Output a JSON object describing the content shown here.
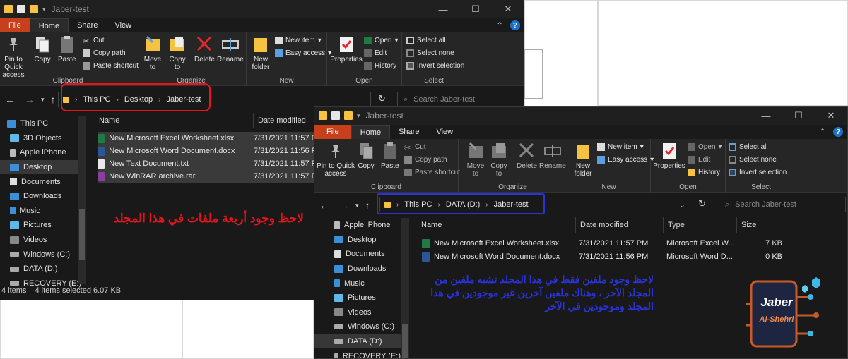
{
  "window1": {
    "title": "Jaber-test",
    "tabs": [
      "File",
      "Home",
      "Share",
      "View"
    ],
    "ribbon": {
      "clipboard": {
        "pin": "Pin to Quick access",
        "copy": "Copy",
        "paste": "Paste",
        "cut": "Cut",
        "copy_path": "Copy path",
        "paste_shortcut": "Paste shortcut",
        "label": "Clipboard"
      },
      "organize": {
        "move_to": "Move to",
        "copy_to": "Copy to",
        "delete": "Delete",
        "rename": "Rename",
        "label": "Organize"
      },
      "new": {
        "new_folder": "New folder",
        "new_item": "New item",
        "easy_access": "Easy access",
        "label": "New"
      },
      "open": {
        "properties": "Properties",
        "open": "Open",
        "edit": "Edit",
        "history": "History",
        "label": "Open"
      },
      "select": {
        "select_all": "Select all",
        "select_none": "Select none",
        "invert": "Invert selection",
        "label": "Select"
      }
    },
    "breadcrumb": [
      "This PC",
      "Desktop",
      "Jaber-test"
    ],
    "search_placeholder": "Search Jaber-test",
    "nav": [
      "This PC",
      "3D Objects",
      "Apple iPhone",
      "Desktop",
      "Documents",
      "Downloads",
      "Music",
      "Pictures",
      "Videos",
      "Windows (C:)",
      "DATA (D:)",
      "RECOVERY (E:)"
    ],
    "columns": [
      "Name",
      "Date modified"
    ],
    "files": [
      {
        "name": "New Microsoft Excel Worksheet.xlsx",
        "date": "7/31/2021 11:57 P"
      },
      {
        "name": "New Microsoft Word Document.docx",
        "date": "7/31/2021 11:56 P"
      },
      {
        "name": "New Text Document.txt",
        "date": "7/31/2021 11:57 P"
      },
      {
        "name": "New WinRAR archive.rar",
        "date": "7/31/2021 11:57 P"
      }
    ],
    "status": {
      "count": "4 items",
      "selected": "4 items selected  6.07 KB"
    },
    "note": "لاحظ وجود أربعة ملفات في هذا المجلد"
  },
  "window2": {
    "title": "Jaber-test",
    "tabs": [
      "File",
      "Home",
      "Share",
      "View"
    ],
    "ribbon": {
      "clipboard": {
        "pin": "Pin to Quick access",
        "copy": "Copy",
        "paste": "Paste",
        "cut": "Cut",
        "copy_path": "Copy path",
        "paste_shortcut": "Paste shortcut",
        "label": "Clipboard"
      },
      "organize": {
        "move_to": "Move to",
        "copy_to": "Copy to",
        "delete": "Delete",
        "rename": "Rename",
        "label": "Organize"
      },
      "new": {
        "new_folder": "New folder",
        "new_item": "New item",
        "easy_access": "Easy access",
        "label": "New"
      },
      "open": {
        "properties": "Properties",
        "open": "Open",
        "edit": "Edit",
        "history": "History",
        "label": "Open"
      },
      "select": {
        "select_all": "Select all",
        "select_none": "Select none",
        "invert": "Invert selection",
        "label": "Select"
      }
    },
    "breadcrumb": [
      "This PC",
      "DATA (D:)",
      "Jaber-test"
    ],
    "search_placeholder": "Search Jaber-test",
    "nav": [
      "Apple iPhone",
      "Desktop",
      "Documents",
      "Downloads",
      "Music",
      "Pictures",
      "Videos",
      "Windows (C:)",
      "DATA (D:)",
      "RECOVERY (E:)"
    ],
    "columns": [
      "Name",
      "Date modified",
      "Type",
      "Size"
    ],
    "files": [
      {
        "name": "New Microsoft Excel Worksheet.xlsx",
        "date": "7/31/2021 11:57 PM",
        "type": "Microsoft Excel W...",
        "size": "7 KB"
      },
      {
        "name": "New Microsoft Word Document.docx",
        "date": "7/31/2021 11:56 PM",
        "type": "Microsoft Word D...",
        "size": "0 KB"
      }
    ],
    "note": "لاحظ وجود ملفين فقط في هذا المجلد تشبه ملفين من المجلد الآخر ، وهناك ملفين آخرين غير موجودين في هذا المجلد وموجودين في الآخر"
  },
  "logo": {
    "line1": "Jaber",
    "line2": "Al-Shehri"
  },
  "colors": {
    "file_tab": "#c8401b",
    "red_note": "#e8141c",
    "blue_note": "#2a33d8"
  }
}
